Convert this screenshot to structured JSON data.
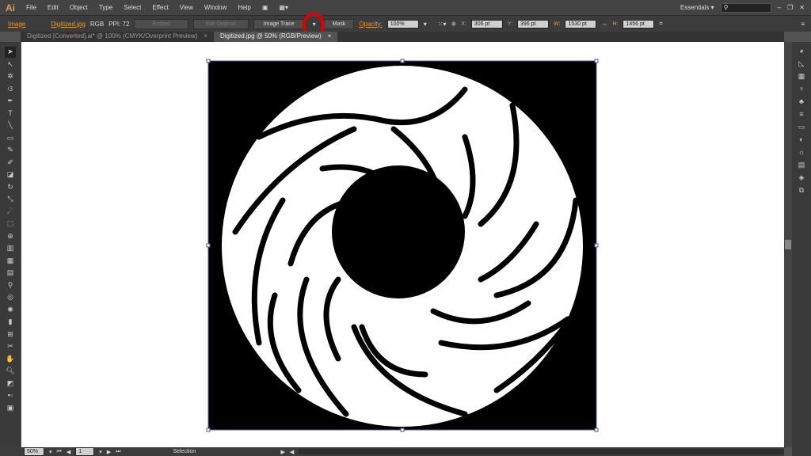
{
  "app": {
    "logo": "Ai",
    "menus": [
      "File",
      "Edit",
      "Object",
      "Type",
      "Select",
      "Effect",
      "View",
      "Window",
      "Help"
    ],
    "workspace": "Essentials",
    "search_placeholder": ""
  },
  "control": {
    "type": "Image",
    "filename": "Digitized.jpg",
    "color_mode": "RGB",
    "ppi": "PPI: 72",
    "embed": "Embed",
    "edit_original": "Edit Original",
    "image_trace": "Image Trace",
    "mask": "Mask",
    "opacity_label": "Opacity:",
    "opacity": "100%",
    "x_label": "X:",
    "x": "306 pt",
    "y_label": "Y:",
    "y": "396 pt",
    "w_label": "W:",
    "w": "1530 pt",
    "h_label": "H:",
    "h": "1456 pt"
  },
  "tabs": [
    {
      "label": "Digitized [Converted].ai* @ 100% (CMYK/Overprint Preview)",
      "active": false
    },
    {
      "label": "Digitized.jpg @ 50% (RGB/Preview)",
      "active": true
    }
  ],
  "status": {
    "zoom": "50%",
    "artboard": "1",
    "tool": "Selection"
  },
  "annotation_color": "#e00000"
}
